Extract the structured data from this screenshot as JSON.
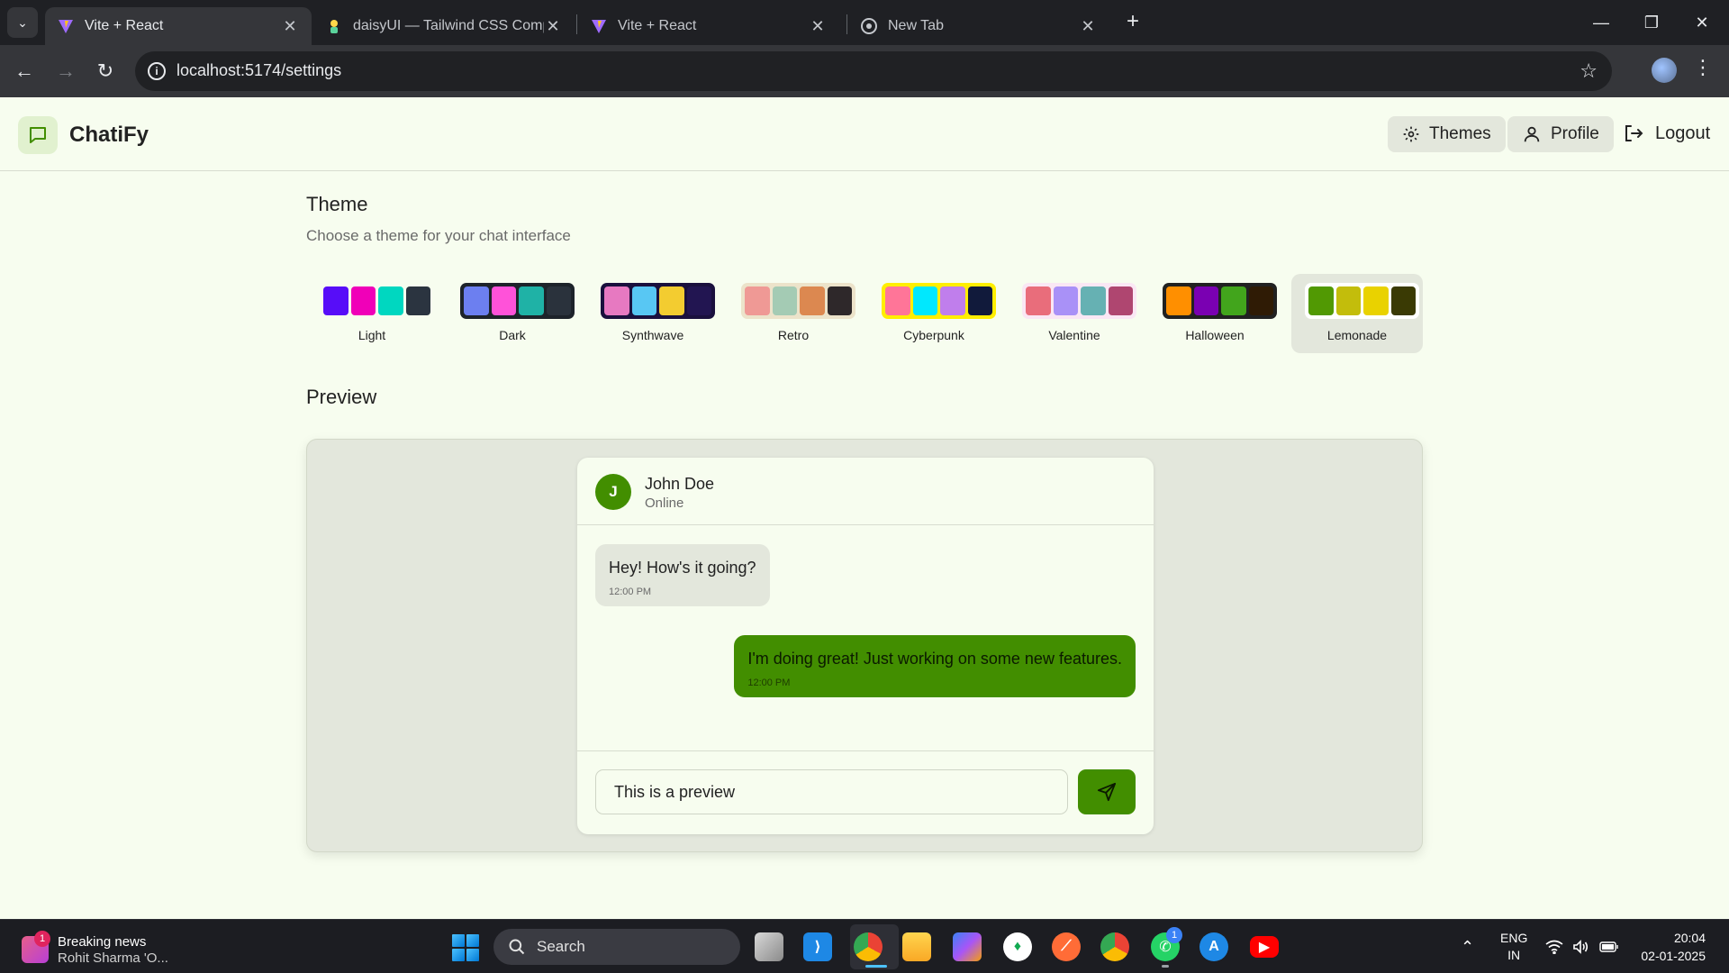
{
  "browser": {
    "tabs": [
      {
        "title": "Vite + React",
        "active": true
      },
      {
        "title": "daisyUI — Tailwind CSS Compo",
        "active": false
      },
      {
        "title": "Vite + React",
        "active": false
      },
      {
        "title": "New Tab",
        "active": false
      }
    ],
    "url": "localhost:5174/settings"
  },
  "app": {
    "brand": "ChatiFy",
    "nav": {
      "themes": "Themes",
      "profile": "Profile",
      "logout": "Logout"
    },
    "theme_section": {
      "title": "Theme",
      "subtitle": "Choose a theme for your chat interface",
      "selected": "Lemonade",
      "themes": [
        {
          "name": "Light",
          "bg": "#f7fdef",
          "colors": [
            "#570df8",
            "#f000b8",
            "#00d7c0",
            "#2b3440"
          ]
        },
        {
          "name": "Dark",
          "bg": "#1d232a",
          "colors": [
            "#6c7ff0",
            "#ff52d9",
            "#1fb2a6",
            "#2a323c"
          ]
        },
        {
          "name": "Synthwave",
          "bg": "#1a103d",
          "colors": [
            "#e779c1",
            "#58c7f3",
            "#f3cc30",
            "#221551"
          ]
        },
        {
          "name": "Retro",
          "bg": "#ece3ca",
          "colors": [
            "#ef9995",
            "#a4cbb4",
            "#dc8850",
            "#2e282a"
          ]
        },
        {
          "name": "Cyberpunk",
          "bg": "#ffee00",
          "colors": [
            "#ff7598",
            "#00e8fe",
            "#c07eec",
            "#111a3b"
          ]
        },
        {
          "name": "Valentine",
          "bg": "#fae7f4",
          "colors": [
            "#e96d7b",
            "#a991f7",
            "#66b1b3",
            "#af4670"
          ]
        },
        {
          "name": "Halloween",
          "bg": "#212121",
          "colors": [
            "#ff8f00",
            "#7a00b2",
            "#42a51c",
            "#2f1b05"
          ]
        },
        {
          "name": "Lemonade",
          "bg": "#ffffff",
          "colors": [
            "#519903",
            "#c3bd0b",
            "#e9d200",
            "#3a3a04"
          ]
        }
      ]
    },
    "preview": {
      "title": "Preview",
      "contact": {
        "initial": "J",
        "name": "John Doe",
        "status": "Online"
      },
      "messages": [
        {
          "text": "Hey! How's it going?",
          "time": "12:00 PM",
          "sent": false
        },
        {
          "text": "I'm doing great! Just working on some new features.",
          "time": "12:00 PM",
          "sent": true
        }
      ],
      "input_value": "This is a preview"
    }
  },
  "taskbar": {
    "news_badge": "1",
    "news_title": "Breaking news",
    "news_sub": "Rohit Sharma 'O...",
    "search_label": "Search",
    "whatsapp_badge": "1",
    "lang": "ENG",
    "region": "IN",
    "time": "20:04",
    "date": "02-01-2025"
  }
}
